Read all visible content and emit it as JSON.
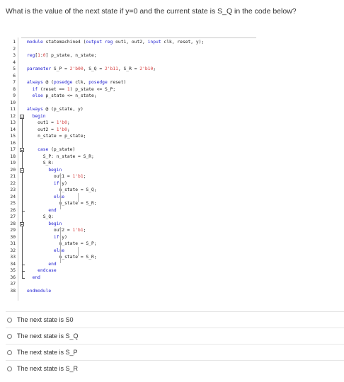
{
  "question": "What is the value of the next state if y=0 and the current state is S_Q in the code below?",
  "code_lines": [
    {
      "n": "1",
      "text": "module statemachine4 (output reg out1, out2, input clk, reset, y);"
    },
    {
      "n": "2",
      "text": ""
    },
    {
      "n": "3",
      "text": "reg[1:0] p_state, n_state;"
    },
    {
      "n": "4",
      "text": ""
    },
    {
      "n": "5",
      "text": "parameter S_P = 2'b00, S_Q = 2'b11, S_R = 2'b10;"
    },
    {
      "n": "6",
      "text": ""
    },
    {
      "n": "7",
      "text": "always @ (posedge clk, posedge reset)"
    },
    {
      "n": "8",
      "text": "  if (reset == 1) p_state <= S_P;"
    },
    {
      "n": "9",
      "text": "  else p_state <= n_state;"
    },
    {
      "n": "10",
      "text": ""
    },
    {
      "n": "11",
      "text": "always @ (p_state, y)"
    },
    {
      "n": "12",
      "text": "  begin"
    },
    {
      "n": "13",
      "text": "    out1 = 1'b0;"
    },
    {
      "n": "14",
      "text": "    out2 = 1'b0;"
    },
    {
      "n": "15",
      "text": "    n_state = p_state;"
    },
    {
      "n": "16",
      "text": ""
    },
    {
      "n": "17",
      "text": "    case (p_state)"
    },
    {
      "n": "18",
      "text": "      S_P: n_state = S_R;"
    },
    {
      "n": "19",
      "text": "      S_R:"
    },
    {
      "n": "20",
      "text": "        begin"
    },
    {
      "n": "21",
      "text": "          out1 = 1'b1;"
    },
    {
      "n": "22",
      "text": "          if(y)"
    },
    {
      "n": "23",
      "text": "            n_state = S_Q;"
    },
    {
      "n": "24",
      "text": "          else"
    },
    {
      "n": "25",
      "text": "            n_state = S_R;"
    },
    {
      "n": "26",
      "text": "        end"
    },
    {
      "n": "27",
      "text": "      S_Q:"
    },
    {
      "n": "28",
      "text": "        begin"
    },
    {
      "n": "29",
      "text": "          out2 = 1'b1;"
    },
    {
      "n": "30",
      "text": "          if(y)"
    },
    {
      "n": "31",
      "text": "            n_state = S_P;"
    },
    {
      "n": "32",
      "text": "          else"
    },
    {
      "n": "33",
      "text": "            n_state = S_R;"
    },
    {
      "n": "34",
      "text": "        end"
    },
    {
      "n": "35",
      "text": "    endcase"
    },
    {
      "n": "36",
      "text": "  end"
    },
    {
      "n": "37",
      "text": ""
    },
    {
      "n": "38",
      "text": "endmodule"
    }
  ],
  "options": [
    "The next state is S0",
    "The next state is S_Q",
    "The next state is S_P",
    "The next state is S_R"
  ]
}
